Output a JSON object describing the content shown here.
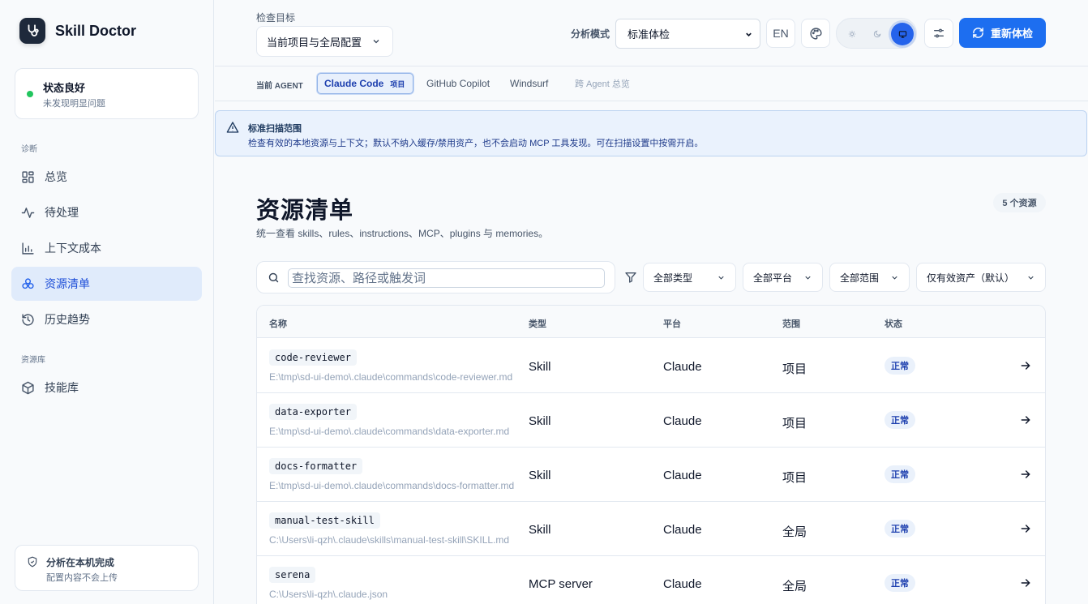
{
  "brand": {
    "name": "Skill Doctor",
    "icon": "stethoscope-icon"
  },
  "status": {
    "title": "状态良好",
    "subtitle": "未发现明显问题",
    "color": "#22c55e"
  },
  "sidebar": {
    "section_diagnose": "诊断",
    "items": [
      {
        "label": "总览",
        "icon": "grid-icon"
      },
      {
        "label": "待处理",
        "icon": "activity-icon"
      },
      {
        "label": "上下文成本",
        "icon": "bar-chart-icon"
      },
      {
        "label": "资源清单",
        "icon": "resources-icon",
        "active": true
      },
      {
        "label": "历史趋势",
        "icon": "history-icon"
      }
    ],
    "section_library": "资源库",
    "library_items": [
      {
        "label": "技能库",
        "icon": "package-icon"
      }
    ],
    "footer": {
      "title": "分析在本机完成",
      "subtitle": "配置内容不会上传"
    }
  },
  "topbar": {
    "target_label": "检查目标",
    "target_value": "当前项目与全局配置",
    "mode_label": "分析模式",
    "mode_value": "标准体检",
    "lang_button": "EN",
    "theme_options": [
      "sun-icon",
      "moon-icon",
      "monitor-icon"
    ],
    "rescan_label": "重新体检",
    "accent": "#1d6ef0"
  },
  "agents": {
    "label": "当前 AGENT",
    "tabs": [
      {
        "label": "Claude Code",
        "tag": "项目",
        "active": true
      },
      {
        "label": "GitHub Copilot"
      },
      {
        "label": "Windsurf"
      },
      {
        "label": "跨 Agent 总览",
        "muted": true
      }
    ]
  },
  "banner": {
    "title": "标准扫描范围",
    "text": "检查有效的本地资源与上下文；默认不纳入缓存/禁用资产，也不会启动 MCP 工具发现。可在扫描设置中按需开启。"
  },
  "main": {
    "title": "资源清单",
    "subtitle": "统一查看 skills、rules、instructions、MCP、plugins 与 memories。",
    "count": "5 个资源",
    "search_placeholder": "查找资源、路径或触发词",
    "filters": [
      "全部类型",
      "全部平台",
      "全部范围",
      "仅有效资产（默认）"
    ]
  },
  "table": {
    "headers": [
      "名称",
      "类型",
      "平台",
      "范围",
      "状态"
    ],
    "rows": [
      {
        "name": "code-reviewer",
        "path": "E:\\tmp\\sd-ui-demo\\.claude\\commands\\code-reviewer.md",
        "type": "Skill",
        "platform": "Claude",
        "scope": "项目",
        "status": "正常"
      },
      {
        "name": "data-exporter",
        "path": "E:\\tmp\\sd-ui-demo\\.claude\\commands\\data-exporter.md",
        "type": "Skill",
        "platform": "Claude",
        "scope": "项目",
        "status": "正常"
      },
      {
        "name": "docs-formatter",
        "path": "E:\\tmp\\sd-ui-demo\\.claude\\commands\\docs-formatter.md",
        "type": "Skill",
        "platform": "Claude",
        "scope": "项目",
        "status": "正常"
      },
      {
        "name": "manual-test-skill",
        "path": "C:\\Users\\li-qzh\\.claude\\skills\\manual-test-skill\\SKILL.md",
        "type": "Skill",
        "platform": "Claude",
        "scope": "全局",
        "status": "正常"
      },
      {
        "name": "serena",
        "path": "C:\\Users\\li-qzh\\.claude.json",
        "type": "MCP server",
        "platform": "Claude",
        "scope": "全局",
        "status": "正常"
      }
    ]
  }
}
